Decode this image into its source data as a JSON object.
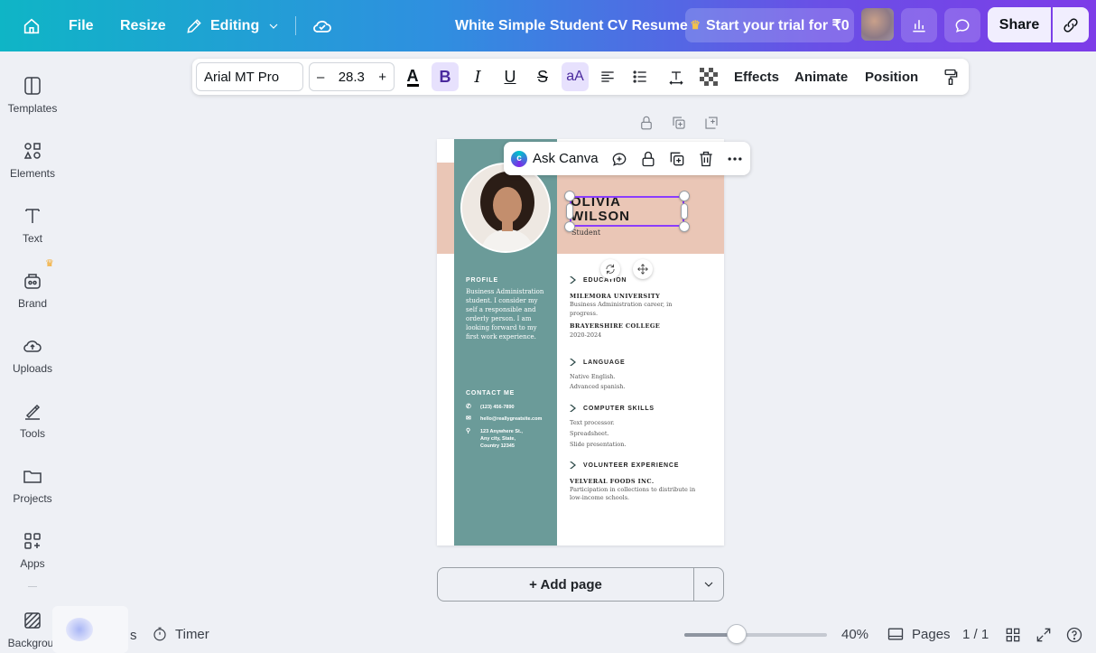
{
  "topbar": {
    "file": "File",
    "resize": "Resize",
    "editing": "Editing",
    "doc_title": "White Simple Student CV Resume",
    "trial": "Start your trial for ₹0",
    "share": "Share"
  },
  "sidebar": {
    "items": [
      {
        "label": "Templates",
        "icon": "templates-icon"
      },
      {
        "label": "Elements",
        "icon": "elements-icon"
      },
      {
        "label": "Text",
        "icon": "text-icon"
      },
      {
        "label": "Brand",
        "icon": "brand-icon"
      },
      {
        "label": "Uploads",
        "icon": "uploads-icon"
      },
      {
        "label": "Tools",
        "icon": "tools-icon"
      },
      {
        "label": "Projects",
        "icon": "projects-icon"
      },
      {
        "label": "Apps",
        "icon": "apps-icon"
      },
      {
        "label": "Backgrour",
        "icon": "background-icon"
      }
    ]
  },
  "toolbar": {
    "font": "Arial MT Pro",
    "font_size": "28.3",
    "minus": "–",
    "plus": "+",
    "effects": "Effects",
    "animate": "Animate",
    "position": "Position"
  },
  "context_menu": {
    "ask_canva": "Ask Canva"
  },
  "resume": {
    "name": "OLIVIA WILSON",
    "name_line1": "OLIVIA",
    "name_line2": "WILSON",
    "role": "Student",
    "profile_heading": "PROFILE",
    "profile_text": "Business Administration student. I consider my self a responsible and orderly person. I am looking forward to my first work experience.",
    "contact_heading": "CONTACT ME",
    "phone": "(123) 456-7890",
    "email": "hello@reallygreatsite.com",
    "address": "123 Anywhere St., Any city, State, Country 12345",
    "education_heading": "EDUCATION",
    "edu1_school": "MILEMORA UNIVERSITY",
    "edu1_text": "Business Administration career, in progress.",
    "edu2_school": "BRAYERSHIRE COLLEGE",
    "edu2_text": "2020-2024",
    "language_heading": "LANGUAGE",
    "language_text": "Native English.\nAdvanced spanish.",
    "skills_heading": "COMPUTER SKILLS",
    "skills_text": "Text processor.\nSpreadsheet.\nSlide presentation.",
    "volunteer_heading": "VOLUNTEER EXPERIENCE",
    "vol_org": "VELVERAL FOODS INC.",
    "vol_text": "Participation in collections to distribute in low-income schools."
  },
  "canvas": {
    "add_page": "+ Add page"
  },
  "bottombar": {
    "notes_partial": "s",
    "timer": "Timer",
    "zoom": "40%",
    "zoom_slider_fraction": 0.37,
    "pages": "Pages",
    "page_count": "1 / 1"
  },
  "colors": {
    "accent": "#8b3dff",
    "resume_teal": "#6b9b99",
    "resume_peach": "#eac6b6"
  }
}
